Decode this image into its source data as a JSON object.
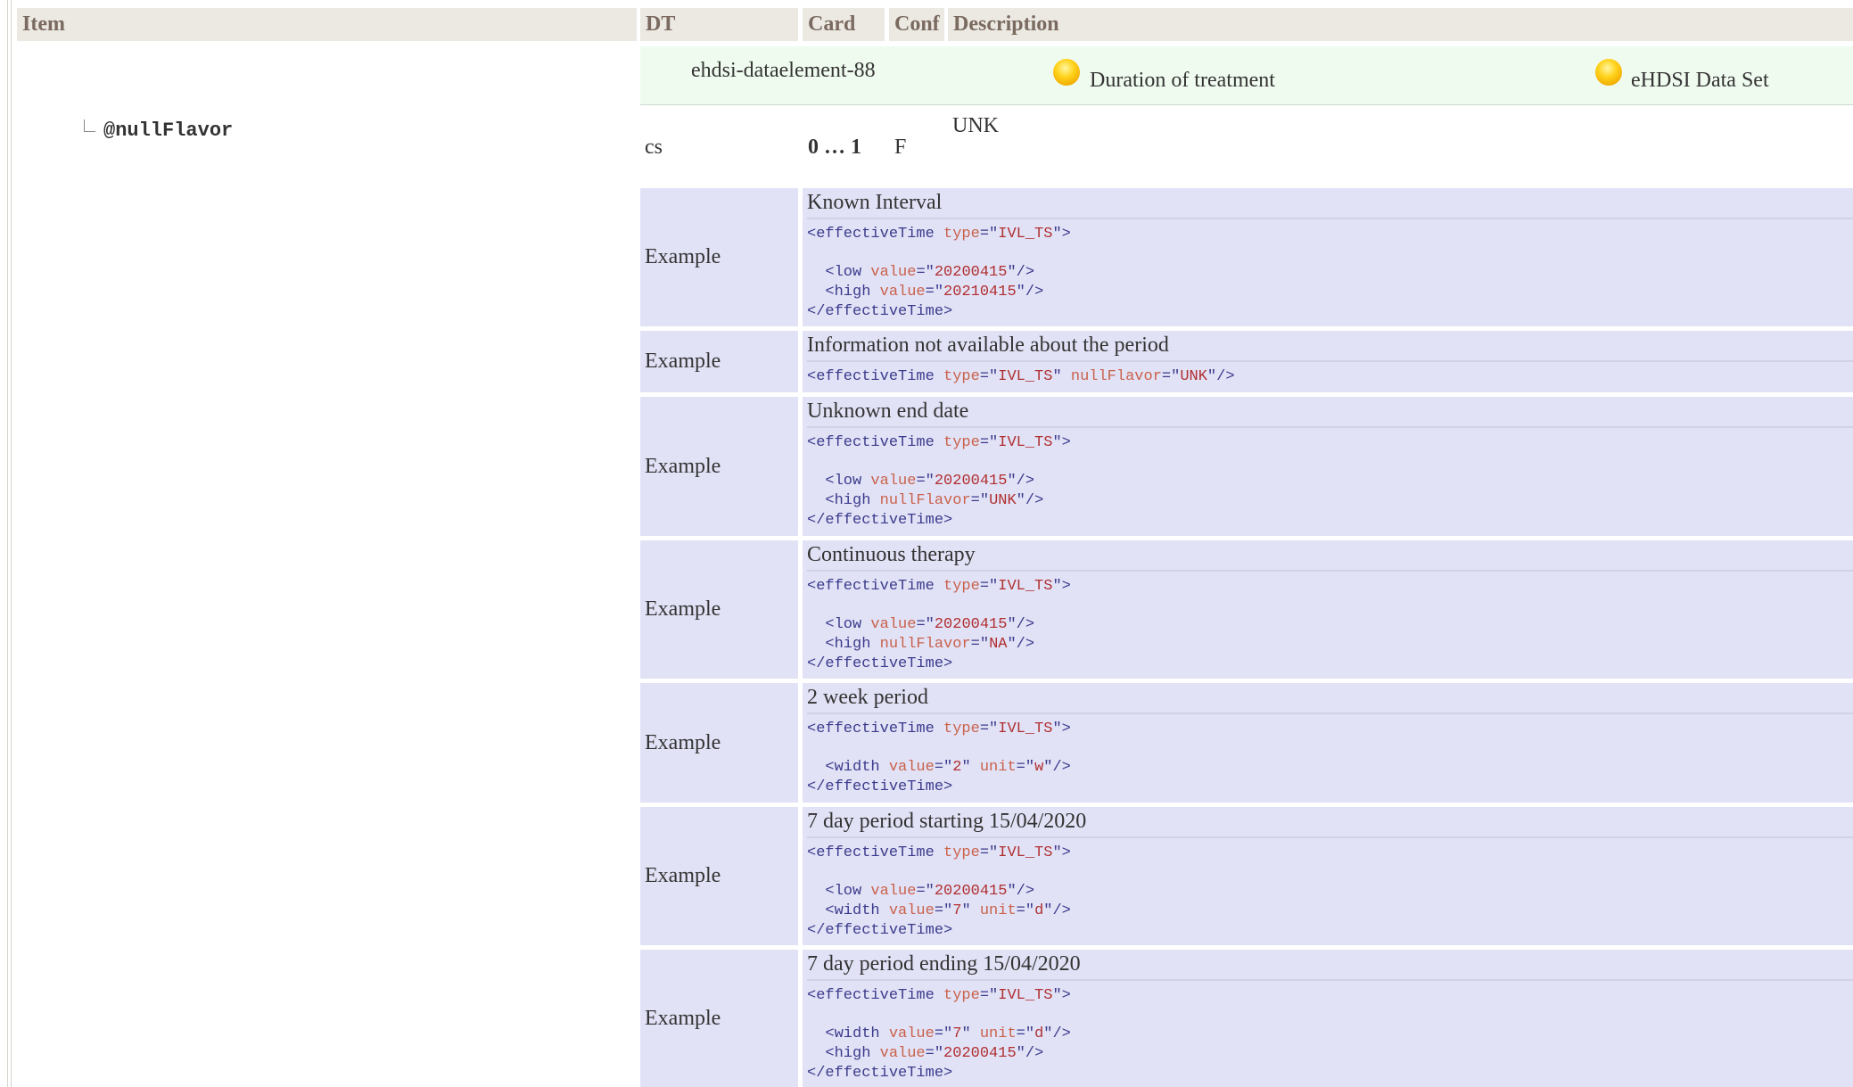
{
  "header": {
    "item": "Item",
    "dt": "DT",
    "card": "Card",
    "conf": "Conf",
    "description": "Description"
  },
  "concept": {
    "id": "ehdsi-dataelement-88",
    "name": "Duration of treatment",
    "dataset": "eHDSI Data Set"
  },
  "attribute": {
    "name": "@nullFlavor",
    "dt": "cs",
    "card": "0 … 1",
    "conf": "F",
    "value": "UNK"
  },
  "examples": [
    {
      "label": "Example",
      "title": "Known Interval",
      "code": [
        [
          [
            "<effectiveTime ",
            "bl"
          ],
          [
            "type",
            "an"
          ],
          [
            "=\"",
            "bl"
          ],
          [
            "IVL_TS",
            "av"
          ],
          [
            "\">",
            "bl"
          ]
        ],
        [],
        [
          [
            "  <low ",
            "bl"
          ],
          [
            "value",
            "an"
          ],
          [
            "=\"",
            "bl"
          ],
          [
            "20200415",
            "av"
          ],
          [
            "\"/>",
            "bl"
          ]
        ],
        [
          [
            "  <high ",
            "bl"
          ],
          [
            "value",
            "an"
          ],
          [
            "=\"",
            "bl"
          ],
          [
            "20210415",
            "av"
          ],
          [
            "\"/>",
            "bl"
          ]
        ],
        [
          [
            "</effectiveTime>",
            "bl"
          ]
        ]
      ]
    },
    {
      "label": "Example",
      "title": "Information not available about the period",
      "code": [
        [
          [
            "<effectiveTime ",
            "bl"
          ],
          [
            "type",
            "an"
          ],
          [
            "=\"",
            "bl"
          ],
          [
            "IVL_TS",
            "av"
          ],
          [
            "\" ",
            "bl"
          ],
          [
            "nullFlavor",
            "an"
          ],
          [
            "=\"",
            "bl"
          ],
          [
            "UNK",
            "av"
          ],
          [
            "\"/>",
            "bl"
          ]
        ]
      ]
    },
    {
      "label": "Example",
      "title": "Unknown end date",
      "code": [
        [
          [
            "<effectiveTime ",
            "bl"
          ],
          [
            "type",
            "an"
          ],
          [
            "=\"",
            "bl"
          ],
          [
            "IVL_TS",
            "av"
          ],
          [
            "\">",
            "bl"
          ]
        ],
        [],
        [
          [
            "  <low ",
            "bl"
          ],
          [
            "value",
            "an"
          ],
          [
            "=\"",
            "bl"
          ],
          [
            "20200415",
            "av"
          ],
          [
            "\"/>",
            "bl"
          ]
        ],
        [
          [
            "  <high ",
            "bl"
          ],
          [
            "nullFlavor",
            "an"
          ],
          [
            "=\"",
            "bl"
          ],
          [
            "UNK",
            "av"
          ],
          [
            "\"/>",
            "bl"
          ]
        ],
        [
          [
            "</effectiveTime>",
            "bl"
          ]
        ]
      ]
    },
    {
      "label": "Example",
      "title": "Continuous therapy",
      "code": [
        [
          [
            "<effectiveTime ",
            "bl"
          ],
          [
            "type",
            "an"
          ],
          [
            "=\"",
            "bl"
          ],
          [
            "IVL_TS",
            "av"
          ],
          [
            "\">",
            "bl"
          ]
        ],
        [],
        [
          [
            "  <low ",
            "bl"
          ],
          [
            "value",
            "an"
          ],
          [
            "=\"",
            "bl"
          ],
          [
            "20200415",
            "av"
          ],
          [
            "\"/>",
            "bl"
          ]
        ],
        [
          [
            "  <high ",
            "bl"
          ],
          [
            "nullFlavor",
            "an"
          ],
          [
            "=\"",
            "bl"
          ],
          [
            "NA",
            "av"
          ],
          [
            "\"/>",
            "bl"
          ]
        ],
        [
          [
            "</effectiveTime>",
            "bl"
          ]
        ]
      ]
    },
    {
      "label": "Example",
      "title": "2 week period",
      "code": [
        [
          [
            "<effectiveTime ",
            "bl"
          ],
          [
            "type",
            "an"
          ],
          [
            "=\"",
            "bl"
          ],
          [
            "IVL_TS",
            "av"
          ],
          [
            "\">",
            "bl"
          ]
        ],
        [],
        [
          [
            "  <width ",
            "bl"
          ],
          [
            "value",
            "an"
          ],
          [
            "=\"",
            "bl"
          ],
          [
            "2",
            "av"
          ],
          [
            "\" ",
            "bl"
          ],
          [
            "unit",
            "an"
          ],
          [
            "=\"",
            "bl"
          ],
          [
            "w",
            "av"
          ],
          [
            "\"/>",
            "bl"
          ]
        ],
        [
          [
            "</effectiveTime>",
            "bl"
          ]
        ]
      ]
    },
    {
      "label": "Example",
      "title": "7 day period starting 15/04/2020",
      "code": [
        [
          [
            "<effectiveTime ",
            "bl"
          ],
          [
            "type",
            "an"
          ],
          [
            "=\"",
            "bl"
          ],
          [
            "IVL_TS",
            "av"
          ],
          [
            "\">",
            "bl"
          ]
        ],
        [],
        [
          [
            "  <low ",
            "bl"
          ],
          [
            "value",
            "an"
          ],
          [
            "=\"",
            "bl"
          ],
          [
            "20200415",
            "av"
          ],
          [
            "\"/>",
            "bl"
          ]
        ],
        [
          [
            "  <width ",
            "bl"
          ],
          [
            "value",
            "an"
          ],
          [
            "=\"",
            "bl"
          ],
          [
            "7",
            "av"
          ],
          [
            "\" ",
            "bl"
          ],
          [
            "unit",
            "an"
          ],
          [
            "=\"",
            "bl"
          ],
          [
            "d",
            "av"
          ],
          [
            "\"/>",
            "bl"
          ]
        ],
        [
          [
            "</effectiveTime>",
            "bl"
          ]
        ]
      ]
    },
    {
      "label": "Example",
      "title": "7 day period ending 15/04/2020",
      "code": [
        [
          [
            "<effectiveTime ",
            "bl"
          ],
          [
            "type",
            "an"
          ],
          [
            "=\"",
            "bl"
          ],
          [
            "IVL_TS",
            "av"
          ],
          [
            "\">",
            "bl"
          ]
        ],
        [],
        [
          [
            "  <width ",
            "bl"
          ],
          [
            "value",
            "an"
          ],
          [
            "=\"",
            "bl"
          ],
          [
            "7",
            "av"
          ],
          [
            "\" ",
            "bl"
          ],
          [
            "unit",
            "an"
          ],
          [
            "=\"",
            "bl"
          ],
          [
            "d",
            "av"
          ],
          [
            "\"/>",
            "bl"
          ]
        ],
        [
          [
            "  <high ",
            "bl"
          ],
          [
            "value",
            "an"
          ],
          [
            "=\"",
            "bl"
          ],
          [
            "20200415",
            "av"
          ],
          [
            "\"/>",
            "bl"
          ]
        ],
        [
          [
            "</effectiveTime>",
            "bl"
          ]
        ]
      ]
    }
  ]
}
